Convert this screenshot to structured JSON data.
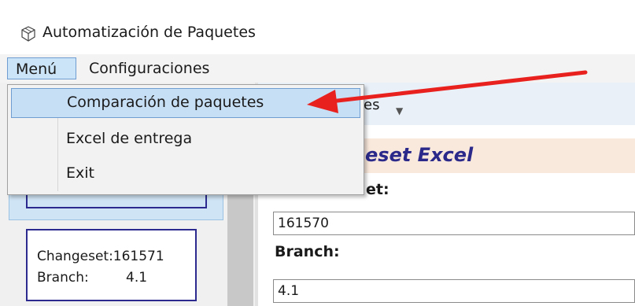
{
  "window": {
    "title": "Automatización de Paquetes",
    "icon": "package-cube-icon"
  },
  "menubar": {
    "items": [
      {
        "label": "Menú",
        "active": true
      },
      {
        "label": "Configuraciones",
        "active": false
      }
    ]
  },
  "dropdown": {
    "items": [
      {
        "label": "Comparación de paquetes",
        "highlighted": true
      },
      {
        "label": "Excel de entrega",
        "highlighted": false
      },
      {
        "label": "Exit",
        "highlighted": false
      }
    ]
  },
  "main": {
    "tab_label_partial": "es",
    "section_title_partial": "eset Excel",
    "changeset_label_partial": "et:",
    "changeset_value": "161570",
    "branch_label": "Branch:",
    "branch_value": "4.1"
  },
  "sidebar": {
    "cards": [
      {
        "changeset_text": "Changeset:161571",
        "branch_key": "Branch:",
        "branch_value": "4.1"
      }
    ]
  },
  "annotation": {
    "arrow_color": "#e8211e"
  }
}
